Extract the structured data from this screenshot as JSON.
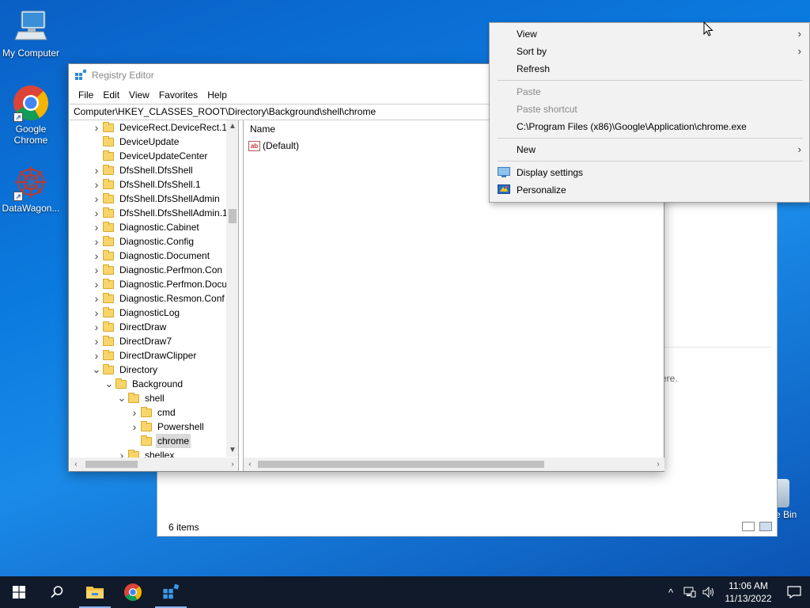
{
  "desktop": {
    "icons": [
      {
        "label": "My Computer"
      },
      {
        "label": "Google Chrome"
      },
      {
        "label": "DataWagon..."
      }
    ],
    "recycle_label": "e Bin"
  },
  "explorer_back": {
    "status": "6 items",
    "empty_msg": "ere."
  },
  "regedit": {
    "title": "Registry Editor",
    "menu": [
      "File",
      "Edit",
      "View",
      "Favorites",
      "Help"
    ],
    "address": "Computer\\HKEY_CLASSES_ROOT\\Directory\\Background\\shell\\chrome",
    "tree": [
      {
        "label": "DeviceRect.DeviceRect.1",
        "depth": 0,
        "expander": "collapsed"
      },
      {
        "label": "DeviceUpdate",
        "depth": 0,
        "expander": "none"
      },
      {
        "label": "DeviceUpdateCenter",
        "depth": 0,
        "expander": "none"
      },
      {
        "label": "DfsShell.DfsShell",
        "depth": 0,
        "expander": "collapsed"
      },
      {
        "label": "DfsShell.DfsShell.1",
        "depth": 0,
        "expander": "collapsed"
      },
      {
        "label": "DfsShell.DfsShellAdmin",
        "depth": 0,
        "expander": "collapsed"
      },
      {
        "label": "DfsShell.DfsShellAdmin.1",
        "depth": 0,
        "expander": "collapsed"
      },
      {
        "label": "Diagnostic.Cabinet",
        "depth": 0,
        "expander": "collapsed"
      },
      {
        "label": "Diagnostic.Config",
        "depth": 0,
        "expander": "collapsed"
      },
      {
        "label": "Diagnostic.Document",
        "depth": 0,
        "expander": "collapsed"
      },
      {
        "label": "Diagnostic.Perfmon.Con",
        "depth": 0,
        "expander": "collapsed"
      },
      {
        "label": "Diagnostic.Perfmon.Docu",
        "depth": 0,
        "expander": "collapsed"
      },
      {
        "label": "Diagnostic.Resmon.Conf",
        "depth": 0,
        "expander": "collapsed"
      },
      {
        "label": "DiagnosticLog",
        "depth": 0,
        "expander": "collapsed"
      },
      {
        "label": "DirectDraw",
        "depth": 0,
        "expander": "collapsed"
      },
      {
        "label": "DirectDraw7",
        "depth": 0,
        "expander": "collapsed"
      },
      {
        "label": "DirectDrawClipper",
        "depth": 0,
        "expander": "collapsed"
      },
      {
        "label": "Directory",
        "depth": 0,
        "expander": "expanded"
      },
      {
        "label": "Background",
        "depth": 1,
        "expander": "expanded"
      },
      {
        "label": "shell",
        "depth": 2,
        "expander": "expanded"
      },
      {
        "label": "cmd",
        "depth": 3,
        "expander": "collapsed"
      },
      {
        "label": "Powershell",
        "depth": 3,
        "expander": "collapsed"
      },
      {
        "label": "chrome",
        "depth": 3,
        "expander": "none",
        "selected": true
      },
      {
        "label": "shellex",
        "depth": 2,
        "expander": "collapsed"
      }
    ],
    "values_header": "Name",
    "values": [
      {
        "name": "(Default)",
        "icon": "string-value-icon"
      }
    ]
  },
  "context_menu": {
    "items": [
      {
        "type": "item",
        "label": "View",
        "submenu": true
      },
      {
        "type": "item",
        "label": "Sort by",
        "submenu": true
      },
      {
        "type": "item",
        "label": "Refresh"
      },
      {
        "type": "sep"
      },
      {
        "type": "item",
        "label": "Paste",
        "disabled": true
      },
      {
        "type": "item",
        "label": "Paste shortcut",
        "disabled": true
      },
      {
        "type": "item",
        "label": "C:\\Program Files (x86)\\Google\\Application\\chrome.exe"
      },
      {
        "type": "sep"
      },
      {
        "type": "item",
        "label": "New",
        "submenu": true
      },
      {
        "type": "sep"
      },
      {
        "type": "item",
        "label": "Display settings",
        "icon": "display-icon"
      },
      {
        "type": "item",
        "label": "Personalize",
        "icon": "personalize-icon"
      }
    ]
  },
  "taskbar": {
    "time": "11:06 AM",
    "date": "11/13/2022"
  }
}
